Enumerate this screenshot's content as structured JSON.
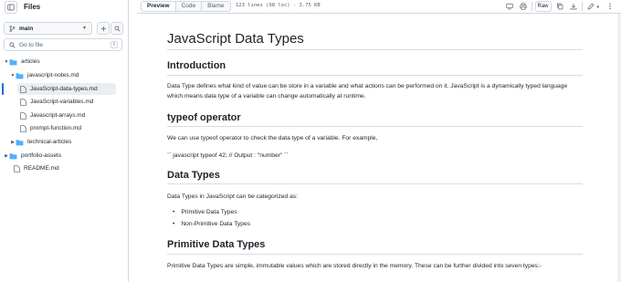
{
  "sidebar": {
    "title": "Files",
    "branch": "main",
    "search_placeholder": "Go to file",
    "shortcut": "t",
    "tree": [
      {
        "label": "articles",
        "type": "folder",
        "expanded": true
      },
      {
        "label": "javascript-notes.md",
        "type": "folder",
        "expanded": true
      },
      {
        "label": "JavaScript-data-types.md",
        "type": "file",
        "selected": true
      },
      {
        "label": "JavaScript-variables.md",
        "type": "file"
      },
      {
        "label": "Javascript-arrays.md",
        "type": "file"
      },
      {
        "label": "prompt-function.md",
        "type": "file"
      },
      {
        "label": "technical-articles",
        "type": "folder",
        "expanded": false
      },
      {
        "label": "portfolio-assets",
        "type": "folder",
        "expanded": false
      },
      {
        "label": "README.md",
        "type": "file"
      }
    ]
  },
  "toolbar": {
    "tabs": [
      "Preview",
      "Code",
      "Blame"
    ],
    "active_tab": "Preview",
    "file_info": "123 lines (98 loc) · 3.75 KB",
    "raw_label": "Raw"
  },
  "doc": {
    "title": "JavaScript Data Types",
    "intro_heading": "Introduction",
    "intro_text": "Data Type defines what kind of value can be store in a variable and what actions can be performed on it. JavaScript is a dynamically typed language which means data type of a variable can change automatically at runtime.",
    "typeof_heading": "typeof operator",
    "typeof_text": "We can use typeof operator to check the data type of a variable. For example,",
    "typeof_code": "`` javascript typeof 42; // Output : \"number\" ``",
    "types_heading": "Data Types",
    "types_text": "Data Types in JavaScript can be categorized as:",
    "types_list": [
      "Primitive Data Types",
      "Non-Primitive Data Types"
    ],
    "primitive_heading": "Primitive Data Types",
    "primitive_text": "Primitive Data Types are simple, immutable values which are stored directly in the memory. These can be further divided into seven types:-"
  },
  "colors": {
    "accent": "#0969da",
    "border": "#d0d7de",
    "folder": "#54aeff"
  }
}
